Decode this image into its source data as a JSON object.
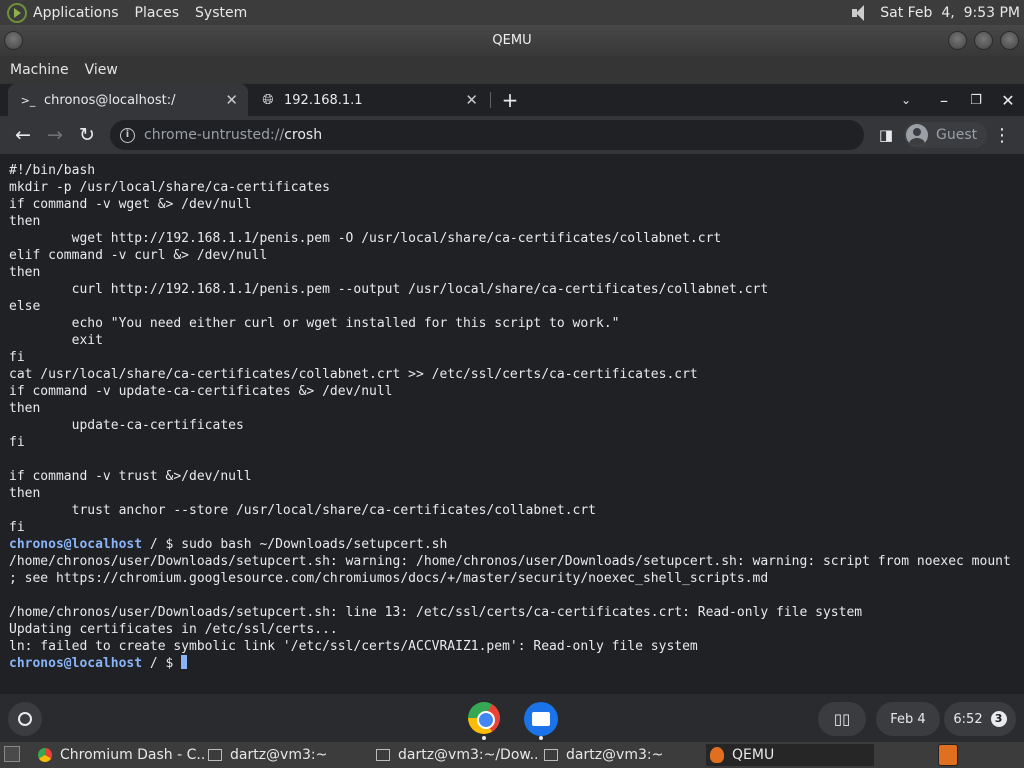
{
  "top_panel": {
    "menus": [
      "Applications",
      "Places",
      "System"
    ],
    "datetime": "Sat Feb  4,  9:53 PM"
  },
  "qemu": {
    "title": "QEMU",
    "menus": [
      "Machine",
      "View"
    ]
  },
  "chrome": {
    "tabs": [
      {
        "icon": "terminal-icon",
        "label": "chronos@localhost:/"
      },
      {
        "icon": "globe-icon",
        "label": "192.168.1.1"
      }
    ],
    "url_scheme": "chrome-untrusted://",
    "url_host": "crosh",
    "profile_label": "Guest"
  },
  "terminal": {
    "lines": [
      {
        "text": "#!/bin/bash"
      },
      {
        "text": "mkdir -p /usr/local/share/ca-certificates"
      },
      {
        "text": "if command -v wget &> /dev/null"
      },
      {
        "text": "then"
      },
      {
        "text": "        wget http://192.168.1.1/penis.pem -O /usr/local/share/ca-certificates/collabnet.crt"
      },
      {
        "text": "elif command -v curl &> /dev/null"
      },
      {
        "text": "then"
      },
      {
        "text": "        curl http://192.168.1.1/penis.pem --output /usr/local/share/ca-certificates/collabnet.crt"
      },
      {
        "text": "else"
      },
      {
        "text": "        echo \"You need either curl or wget installed for this script to work.\""
      },
      {
        "text": "        exit"
      },
      {
        "text": "fi"
      },
      {
        "text": "cat /usr/local/share/ca-certificates/collabnet.crt >> /etc/ssl/certs/ca-certificates.crt"
      },
      {
        "text": "if command -v update-ca-certificates &> /dev/null"
      },
      {
        "text": "then"
      },
      {
        "text": "        update-ca-certificates"
      },
      {
        "text": "fi"
      },
      {
        "text": ""
      },
      {
        "text": "if command -v trust &>/dev/null"
      },
      {
        "text": "then"
      },
      {
        "text": "        trust anchor --store /usr/local/share/ca-certificates/collabnet.crt"
      },
      {
        "text": "fi"
      },
      {
        "prompt": "chronos@localhost",
        "text": " / $ sudo bash ~/Downloads/setupcert.sh"
      },
      {
        "text": "/home/chronos/user/Downloads/setupcert.sh: warning: /home/chronos/user/Downloads/setupcert.sh: warning: script from noexec mount"
      },
      {
        "text": "; see https://chromium.googlesource.com/chromiumos/docs/+/master/security/noexec_shell_scripts.md"
      },
      {
        "text": ""
      },
      {
        "text": "/home/chronos/user/Downloads/setupcert.sh: line 13: /etc/ssl/certs/ca-certificates.crt: Read-only file system"
      },
      {
        "text": "Updating certificates in /etc/ssl/certs..."
      },
      {
        "text": "ln: failed to create symbolic link '/etc/ssl/certs/ACCVRAIZ1.pem': Read-only file system"
      },
      {
        "prompt": "chronos@localhost",
        "text": " / $ ",
        "cursor": true
      }
    ]
  },
  "shelf": {
    "date": "Feb 4",
    "time": "6:52",
    "notification_count": "3"
  },
  "taskbar": {
    "tasks": [
      {
        "icon": "chromium-icon",
        "label": "Chromium Dash - C..."
      },
      {
        "icon": "terminal-icon",
        "label": "dartz@vm3:~"
      },
      {
        "icon": "terminal-icon",
        "label": "dartz@vm3:~/Dow..."
      },
      {
        "icon": "terminal-icon",
        "label": "dartz@vm3:~"
      },
      {
        "icon": "qemu-icon",
        "label": "QEMU"
      }
    ]
  }
}
